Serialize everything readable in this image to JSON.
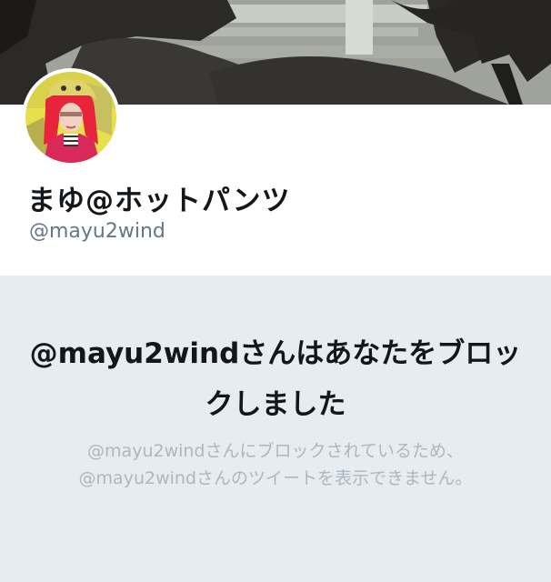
{
  "profile": {
    "display_name": "まゆ@ホットパンツ",
    "screen_name": "@mayu2wind"
  },
  "blocked": {
    "title": "@mayu2windさんはあなたをブロックしました",
    "description": "@mayu2windさんにブロックされているため、@mayu2windさんのツイートを表示できません。"
  },
  "colors": {
    "panel_background": "#e6ecf0",
    "primary_text": "#14171a",
    "secondary_text": "#657786",
    "muted_text": "#aab8c2"
  }
}
